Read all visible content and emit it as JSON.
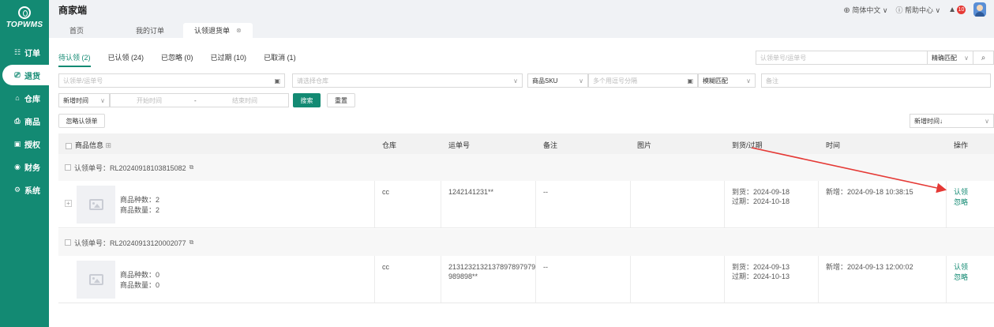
{
  "logo": {
    "text": "TOPWMS"
  },
  "nav": [
    {
      "label": "订单",
      "icon": "list-icon",
      "glyph": "☷",
      "active": false
    },
    {
      "label": "退货",
      "icon": "return-icon",
      "glyph": "⎚",
      "active": true
    },
    {
      "label": "仓库",
      "icon": "warehouse-icon",
      "glyph": "⌂",
      "active": false
    },
    {
      "label": "商品",
      "icon": "goods-icon",
      "glyph": "⎙",
      "active": false
    },
    {
      "label": "授权",
      "icon": "auth-icon",
      "glyph": "▣",
      "active": false
    },
    {
      "label": "财务",
      "icon": "finance-icon",
      "glyph": "◉",
      "active": false
    },
    {
      "label": "系统",
      "icon": "settings-icon",
      "glyph": "⚙",
      "active": false
    }
  ],
  "header": {
    "brand": "商家端",
    "language": "简体中文",
    "help": "帮助中心",
    "notif_count": "10"
  },
  "page_tabs": [
    {
      "label": "首页",
      "active": false
    },
    {
      "label": "我的订单",
      "active": false
    },
    {
      "label": "认领退货单",
      "active": true
    }
  ],
  "status_tabs": [
    {
      "label": "待认领 (2)",
      "active": true
    },
    {
      "label": "已认领 (24)",
      "active": false
    },
    {
      "label": "已忽略 (0)",
      "active": false
    },
    {
      "label": "已过期 (10)",
      "active": false
    },
    {
      "label": "已取消 (1)",
      "active": false
    }
  ],
  "quick_search": {
    "placeholder": "认领单号/运单号",
    "mode": "精确匹配"
  },
  "filters": {
    "claim_no_placeholder": "认领单/运单号",
    "warehouse_placeholder": "请选择仓库",
    "sku_select": "商品SKU",
    "sku_placeholder": "多个用逗号分隔",
    "match_mode": "模糊匹配",
    "remark_placeholder": "备注",
    "time_type": "新增时间",
    "start_placeholder": "开始时间",
    "range_sep": "-",
    "end_placeholder": "结束时间",
    "search_btn": "搜索",
    "reset_btn": "重置",
    "ignore_btn": "忽略认领单",
    "sort_select": "新增时间↓"
  },
  "table": {
    "columns": [
      "商品信息",
      "仓库",
      "运单号",
      "备注",
      "图片",
      "到货/过期",
      "时间",
      "操作"
    ],
    "groups": [
      {
        "claim_label": "认领单号：RL20240918103815082",
        "kinds": "商品种数：2",
        "qty": "商品数量：2",
        "warehouse": "cc",
        "tracking_1": "1242141231**",
        "tracking_2": "",
        "remark": "--",
        "arrive": "到货：2024-09-18",
        "expire": "过期：2024-10-18",
        "time": "新增：2024-09-18 10:38:15",
        "action_claim": "认领",
        "action_ignore": "忽略"
      },
      {
        "claim_label": "认领单号：RL20240913120002077",
        "kinds": "商品种数：0",
        "qty": "商品数量：0",
        "warehouse": "cc",
        "tracking_1": "2131232132137897897979",
        "tracking_2": "989898**",
        "remark": "--",
        "arrive": "到货：2024-09-13",
        "expire": "过期：2024-10-13",
        "time": "新增：2024-09-13 12:00:02",
        "action_claim": "认领",
        "action_ignore": "忽略"
      }
    ]
  },
  "colors": {
    "brand": "#138a73",
    "annotation_arrow": "#e53935"
  }
}
